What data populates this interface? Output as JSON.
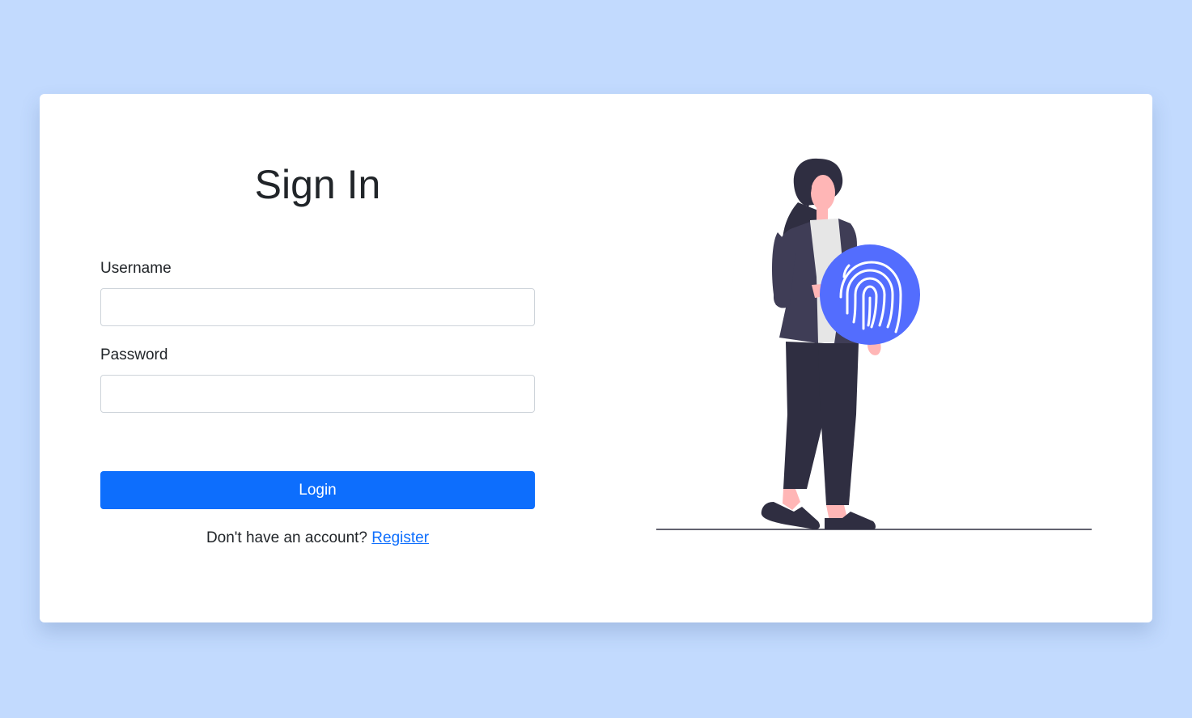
{
  "login": {
    "title": "Sign In",
    "username_label": "Username",
    "username_value": "",
    "password_label": "Password",
    "password_value": "",
    "submit_label": "Login",
    "no_account_text": "Don't have an account?",
    "register_link": "Register"
  },
  "colors": {
    "page_background": "#c2dafe",
    "primary": "#0d6efd",
    "fingerprint_circle": "#536dfe",
    "figure_dark": "#2f2e41",
    "skin": "#ffb6b6"
  },
  "icons": {
    "illustration": "person-with-fingerprint-illustration",
    "fingerprint": "fingerprint-icon"
  }
}
